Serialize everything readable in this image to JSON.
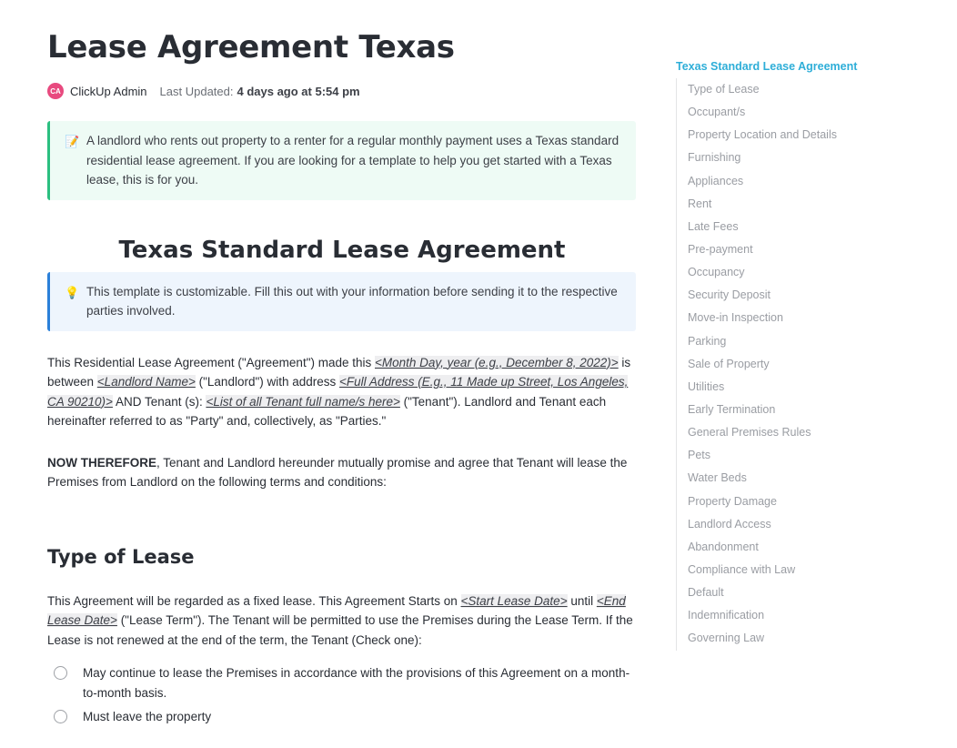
{
  "doc": {
    "title": "Lease Agreement Texas",
    "author_initials": "CA",
    "author": "ClickUp Admin",
    "updated_label": "Last Updated:",
    "updated_value": "4 days ago at 5:54 pm"
  },
  "intro_callout": {
    "icon": "memo-icon",
    "text": "A landlord who rents out property to a renter for a regular monthly payment uses a Texas standard residential lease agreement. If you are looking for a template to help you get started with a Texas lease, this is for you."
  },
  "agreement_heading": "Texas Standard Lease Agreement",
  "tip_callout": {
    "icon": "lightbulb-icon",
    "text": "This template is customizable. Fill this out with your information before sending it to the respective parties involved."
  },
  "paragraph1": {
    "t1": "This Residential Lease Agreement (\"Agreement\") made this ",
    "ph1": "<Month Day, year (e.g., December 8, 2022)>",
    "t2": " is between ",
    "ph2": "<Landlord Name>",
    "t3": " (\"Landlord\") with address  ",
    "ph3": "<Full Address (E.g., 11 Made up Street, Los Angeles, CA 90210)>",
    "t4": " AND Tenant (s): ",
    "ph4": "<List of all Tenant full name/s here>",
    "t5": " (\"Tenant\"). Landlord and Tenant each hereinafter referred to as \"Party\" and, collectively, as \"Parties.\""
  },
  "paragraph2": {
    "bold": "NOW THEREFORE",
    "text": ", Tenant and Landlord hereunder mutually promise and agree that Tenant will lease the Premises from Landlord on the following terms and conditions:"
  },
  "type_of_lease": {
    "heading": "Type of Lease",
    "t1": "This Agreement will be regarded as a fixed lease. This Agreement Starts on ",
    "ph1": "<Start Lease Date>",
    "t2": " until ",
    "ph2": "<End Lease Date>",
    "t3": " (\"Lease Term\"). The Tenant will be permitted to use the Premises during the Lease Term. If the Lease is not renewed at the end of the term, the Tenant (Check one):",
    "options": [
      "May continue to lease the Premises in accordance with the provisions of this Agreement on a month-to-month basis.",
      "Must leave the property"
    ]
  },
  "toc": {
    "title": "Texas Standard Lease Agreement",
    "items": [
      "Type of Lease",
      "Occupant/s",
      "Property Location and Details",
      "Furnishing",
      "Appliances",
      "Rent",
      "Late Fees",
      "Pre-payment",
      "Occupancy",
      "Security Deposit",
      "Move-in Inspection",
      "Parking",
      "Sale of Property",
      "Utilities",
      "Early Termination",
      "General Premises Rules",
      "Pets",
      "Water Beds",
      "Property Damage",
      "Landlord Access",
      "Abandonment",
      "Compliance with Law",
      "Default",
      "Indemnification",
      "Governing Law"
    ]
  },
  "colors": {
    "toc_accent": "#2eaed8",
    "green_callout_border": "#2bbf80",
    "blue_callout_border": "#2b80d9",
    "avatar": "#e84a7f"
  }
}
